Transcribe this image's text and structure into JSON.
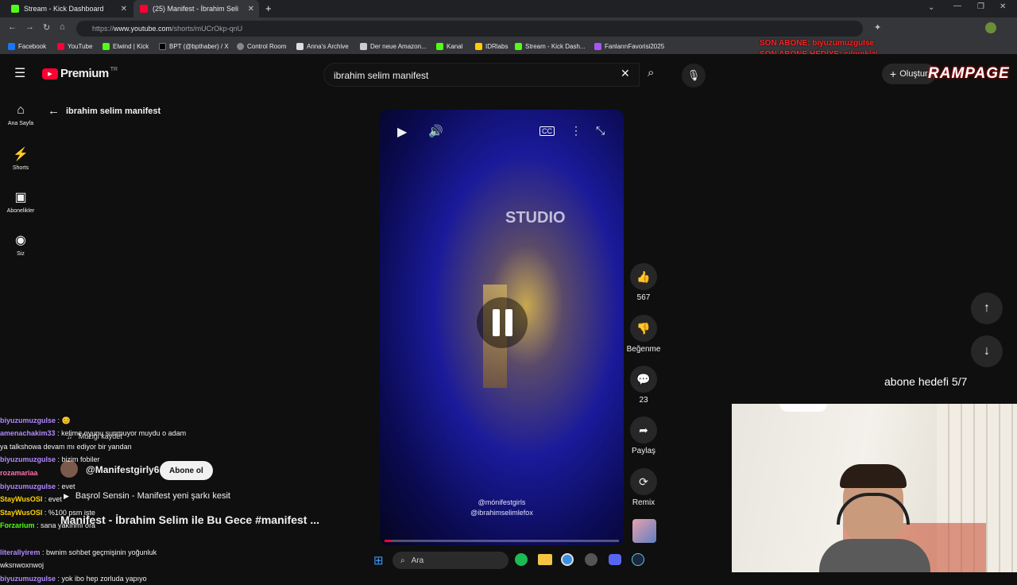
{
  "browser": {
    "tabs": [
      {
        "title": "Stream - Kick Dashboard",
        "color": "#53fc18"
      },
      {
        "title": "(25) Manifest - İbrahim Seli",
        "color": "#ff0033"
      }
    ],
    "url_prefix": "https://",
    "url_domain": "www.youtube.com",
    "url_path": "/shorts/mUCrOkp-qnU",
    "bookmarks": [
      "Facebook",
      "YouTube",
      "Elwind | Kick",
      "BPT (@bpthaber) / X",
      "Control Room",
      "Anna's Archive",
      "Der neue Amazon...",
      "Kanal",
      "IDRlabs",
      "Stream - Kick Dash...",
      "FanlarınFavorisi2025"
    ]
  },
  "youtube": {
    "logo_text": "Premium",
    "region": "TR",
    "search_value": "ibrahim selim manifest",
    "back_label": "ibrahim selim manifest",
    "create_label": "Oluştur",
    "sidebar": [
      {
        "label": "Ana Sayfa",
        "icon": "home-icon"
      },
      {
        "label": "Shorts",
        "icon": "shorts-icon"
      },
      {
        "label": "Abonelikler",
        "icon": "subscriptions-icon"
      },
      {
        "label": "Siz",
        "icon": "account-icon"
      }
    ],
    "video": {
      "watermark": "STUDIO",
      "tag1": "@mónifestgirls",
      "tag2": "@ibrahimselimlefox",
      "channel": "@Manifestgirly6",
      "subscribe": "Abone ol",
      "save_music": "Müziği kaydet",
      "song": "Başrol Sensin - Manifest yeni şarkı kesit",
      "title": "Manifest - İbrahim Selim ile Bu Gece #manifest ..."
    },
    "actions": {
      "likes": "567",
      "dislike": "Beğenme",
      "comments": "23",
      "share": "Paylaş",
      "remix": "Remix"
    }
  },
  "overlay": {
    "alert1": "SON ABONE: biyuzumuzgulse",
    "alert2": "SON ABONE HEDİYE: cılgınkizi",
    "brand": "RAMPAGE",
    "goal": "abone hedefi 5/7"
  },
  "chat": [
    {
      "user": "biyuzumuzgulse",
      "msg": ": 😊",
      "color": "#b088ff"
    },
    {
      "user": "amenachakim33",
      "msg": ": kelime oyunu sunmuyor muydu o adam",
      "color": "#b088ff"
    },
    {
      "user": "",
      "msg": "ya talkshowa devam mı ediyor bir yandan",
      "color": "#ffffff"
    },
    {
      "user": "biyuzumuzgulse",
      "msg": ": bizim fobiler",
      "color": "#b088ff"
    },
    {
      "user": "rozamariaa",
      "msg": ": ...",
      "color": "#ff6fae"
    },
    {
      "user": "biyuzumuzgulse",
      "msg": ": evet",
      "color": "#b088ff"
    },
    {
      "user": "StayWusOSI",
      "msg": ": evet",
      "color": "#ffd400"
    },
    {
      "user": "StayWusOSI",
      "msg": ": %100 psm işte",
      "color": "#ffd400"
    },
    {
      "user": "Forzarium",
      "msg": ": sana yakınmı ora",
      "color": "#53fc18"
    },
    {
      "user": "literallyirem",
      "msg": ": bwnim sohbet geçmişinin yoğunluk",
      "color": "#b088ff"
    },
    {
      "user": "",
      "msg": "wksnwoxnwoj",
      "color": "#ffffff"
    },
    {
      "user": "biyuzumuzgulse",
      "msg": ": yok ibo hep zorluda yapıyo",
      "color": "#b088ff"
    }
  ],
  "taskbar": {
    "search": "Ara"
  }
}
